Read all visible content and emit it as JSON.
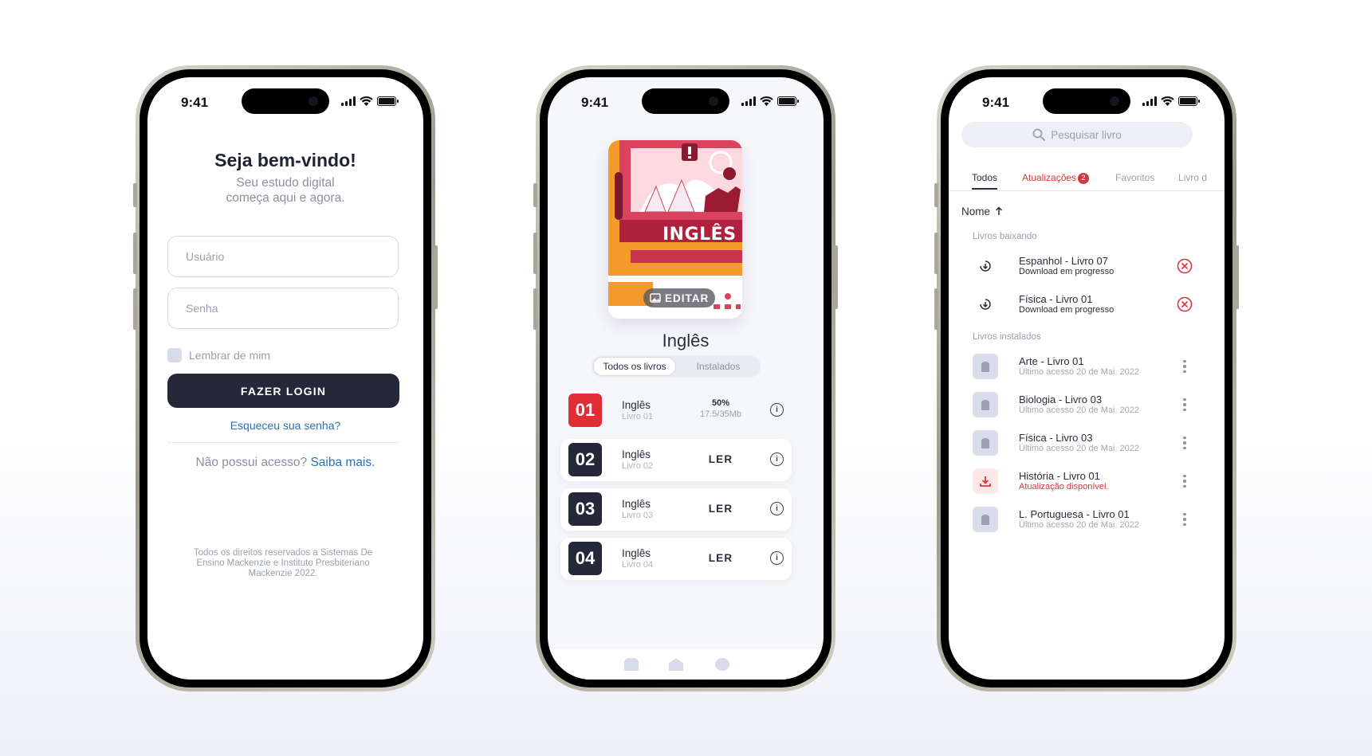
{
  "status_bar": {
    "time": "9:41"
  },
  "login": {
    "title": "Seja bem-vindo!",
    "subtitle_line1": "Seu estudo digital",
    "subtitle_line2": "começa aqui e agora.",
    "username_placeholder": "Usuário",
    "password_placeholder": "Senha",
    "remember_label": "Lembrar de mim",
    "login_button": "FAZER LOGIN",
    "forgot_link": "Esqueceu sua senha?",
    "no_access_text": "Não possui acesso?",
    "learn_more_link": "Saiba mais.",
    "copyright": "Todos os direitos reservados a Sistemas De Ensino Mackenzie e Instituto Presbiteriano Mackenzie 2022."
  },
  "book": {
    "cover_title": "INGLÊS",
    "edit_label": "EDITAR",
    "title": "Inglês",
    "filters": [
      "Todos os livros",
      "Instalados"
    ],
    "volumes": [
      {
        "number": "01",
        "subject": "Inglês",
        "name": "Livro 01",
        "progress": "50%",
        "size": "17.5/35Mb",
        "color": "#e12d35",
        "downloading": true
      },
      {
        "number": "02",
        "subject": "Inglês",
        "name": "Livro 02",
        "action": "LER",
        "color": "#252838"
      },
      {
        "number": "03",
        "subject": "Inglês",
        "name": "Livro 03",
        "action": "LER",
        "color": "#252838"
      },
      {
        "number": "04",
        "subject": "Inglês",
        "name": "Livro 04",
        "action": "LER",
        "color": "#252838"
      }
    ],
    "tabbar_icons": [
      "backpack-icon",
      "home-icon",
      "gear-icon"
    ]
  },
  "library": {
    "search_placeholder": "Pesquisar livro",
    "tabs": [
      "Todos",
      "Atualizações",
      "Favoritos",
      "Livro d"
    ],
    "updates_badge": "2",
    "sort_label": "Nome",
    "section_downloading": "Livros baixando",
    "section_installed": "Livros instalados",
    "downloading": [
      {
        "title": "Espanhol - Livro 07",
        "status": "Download em progresso"
      },
      {
        "title": "Física - Livro 01",
        "status": "Download em progresso"
      }
    ],
    "installed": [
      {
        "title": "Arte - Livro 01",
        "status": "Último acesso 20 de Mai. 2022",
        "update": false
      },
      {
        "title": "Biologia - Livro 03",
        "status": "Último acesso 20 de Mai. 2022",
        "update": false
      },
      {
        "title": "Física - Livro 03",
        "status": "Último acesso 20 de Mai. 2022",
        "update": false
      },
      {
        "title": "História - Livro 01",
        "status": "Atualização disponível.",
        "update": true
      },
      {
        "title": "L. Portuguesa - Livro 01",
        "status": "Último acesso 20 de Mai. 2022",
        "update": false
      }
    ],
    "accent_color": "#d8363e"
  }
}
